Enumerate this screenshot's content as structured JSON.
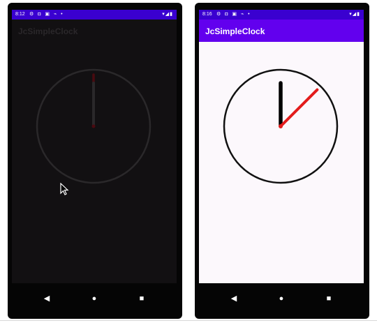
{
  "left_phone": {
    "status_time": "8:12",
    "status_icons_left": "⚙ ◘ ▣ ⌁ •",
    "status_icons_right": "▾◢▮",
    "app_title": "JcSimpleClock",
    "theme": "dark",
    "colors": {
      "background": "#121012",
      "dial": "#2a282a",
      "hour_hand": "#2a282a",
      "minute_hand": "#4a0a10",
      "title": "#2a272a"
    },
    "clock": {
      "hour_angle_deg": 0,
      "minute_angle_deg": 0
    }
  },
  "right_phone": {
    "status_time": "8:16",
    "status_icons_left": "⚙ ◘ ▣ ⌁ •",
    "status_icons_right": "▾◢▮",
    "app_title": "JcSimpleClock",
    "theme": "light",
    "colors": {
      "app_bar": "#6200ee",
      "status_bar": "#3a00d0",
      "background": "#fcf8fc",
      "dial": "#111111",
      "hour_hand": "#000000",
      "minute_hand": "#e31c1c"
    },
    "clock": {
      "hour_angle_deg": 0,
      "minute_angle_deg": 45
    }
  },
  "navigation": {
    "back_icon": "◀",
    "home_icon": "●",
    "recent_icon": "■"
  }
}
